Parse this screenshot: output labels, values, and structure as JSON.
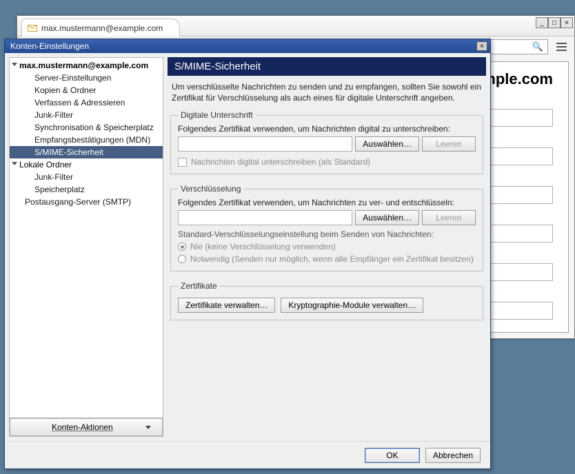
{
  "browser": {
    "tab_title": "max.mustermann@example.com",
    "page_heading": "mple.com"
  },
  "dialog": {
    "title": "Konten-Einstellungen",
    "sidebar": {
      "account": "max.mustermann@example.com",
      "items": [
        "Server-Einstellungen",
        "Kopien & Ordner",
        "Verfassen & Adressieren",
        "Junk-Filter",
        "Synchronisation & Speicherplatz",
        "Empfangsbestätigungen (MDN)",
        "S/MIME-Sicherheit"
      ],
      "local_root": "Lokale Ordner",
      "local_items": [
        "Junk-Filter",
        "Speicherplatz"
      ],
      "smtp": "Postausgang-Server (SMTP)",
      "actions_btn": "Konten-Aktionen"
    },
    "main": {
      "heading": "S/MIME-Sicherheit",
      "description": "Um verschlüsselte Nachrichten zu senden und zu empfangen, sollten Sie sowohl ein Zertifikat für Verschlüsselung als auch eines für digitale Unterschrift angeben.",
      "sign_group": {
        "legend": "Digitale Unterschrift",
        "hint": "Folgendes Zertifikat verwenden, um Nachrichten digital zu unterschreiben:",
        "select_btn": "Auswählen…",
        "clear_btn": "Leeren",
        "checkbox": "Nachrichten digital unterschreiben (als Standard)"
      },
      "enc_group": {
        "legend": "Verschlüsselung",
        "hint": "Folgendes Zertifikat verwenden, um Nachrichten zu ver- und entschlüsseln:",
        "select_btn": "Auswählen…",
        "clear_btn": "Leeren",
        "default_label": "Standard-Verschlüsselungseinstellung beim Senden von Nachrichten:",
        "opt_never": "Nie (keine Verschlüsselung verwenden)",
        "opt_required": "Notwendig (Senden nur möglich, wenn alle Empfänger ein Zertifikat besitzen)"
      },
      "cert_group": {
        "legend": "Zertifikate",
        "manage_certs": "Zertifikate verwalten…",
        "manage_crypto": "Kryptographie-Module verwalten…"
      }
    },
    "footer": {
      "ok": "OK",
      "cancel": "Abbrechen"
    }
  }
}
